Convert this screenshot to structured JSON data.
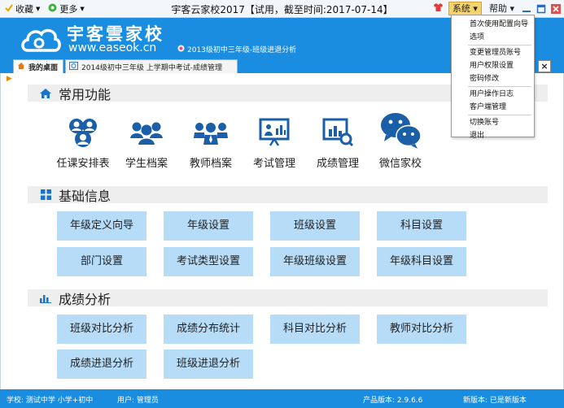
{
  "titlebar": {
    "favorites_label": "收藏",
    "more_label": "更多",
    "window_title": "宇客云家校2017【试用，截至时间:2017-07-14】",
    "system_menu": "系统",
    "help_menu": "帮助"
  },
  "banner": {
    "brand": "宇客雲家校",
    "domain": "www.easeok.cn",
    "current_info": "2013级初中三年级-班级进退分析"
  },
  "tabs": [
    {
      "label": "我的桌面"
    },
    {
      "label": "2014级初中三年级 上学期中考试-成绩管理"
    }
  ],
  "tab_close_glyph": "×",
  "sections": {
    "common": {
      "title": "常用功能"
    },
    "basic": {
      "title": "基础信息"
    },
    "analysis": {
      "title": "成绩分析"
    }
  },
  "features": [
    {
      "label": "任课安排表",
      "icon": "teacher-assignment-icon"
    },
    {
      "label": "学生档案",
      "icon": "students-icon"
    },
    {
      "label": "教师档案",
      "icon": "teachers-icon"
    },
    {
      "label": "考试管理",
      "icon": "exam-board-icon"
    },
    {
      "label": "成绩管理",
      "icon": "score-chart-icon"
    },
    {
      "label": "微信家校",
      "icon": "wechat-icon"
    }
  ],
  "basic_buttons": [
    "年级定义向导",
    "年级设置",
    "班级设置",
    "科目设置",
    "部门设置",
    "考试类型设置",
    "年级班级设置",
    "年级科目设置"
  ],
  "analysis_buttons": [
    "班级对比分析",
    "成绩分布统计",
    "科目对比分析",
    "教师对比分析",
    "成绩进退分析",
    "班级进退分析"
  ],
  "status": {
    "school": "学校: 测试中学 小学+初中",
    "user": "用户: 管理员",
    "version": "产品版本: 2.9.6.6",
    "latest": "新版本: 已是新版本"
  },
  "dropdown_items": [
    "首次使用配置向导",
    "选项",
    "变更管理员账号",
    "用户权限设置",
    "密码修改",
    "用户操作日志",
    "客户端管理",
    "切换账号",
    "退出"
  ],
  "colors": {
    "banner_blue": "#1b8de0",
    "button_blue": "#b7dcf8",
    "icon_blue": "#1a5fa8",
    "system_menu_highlight": "#f7d46b"
  }
}
